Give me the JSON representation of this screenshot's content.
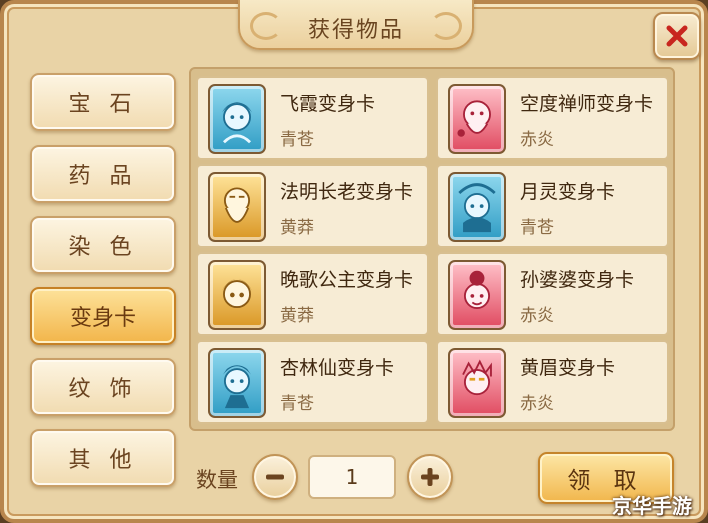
{
  "title": "获得物品",
  "colors": {
    "panel_bg": "#e9d3a6",
    "active_tab": "#f2b54a",
    "close_x": "#c8261f"
  },
  "categories": [
    {
      "label": "宝 石",
      "active": false
    },
    {
      "label": "药 品",
      "active": false
    },
    {
      "label": "染 色",
      "active": false
    },
    {
      "label": "变身卡",
      "active": true
    },
    {
      "label": "纹 饰",
      "active": false
    },
    {
      "label": "其 他",
      "active": false
    }
  ],
  "items": [
    {
      "name": "飞霞变身卡",
      "tier": "青苍",
      "icon": "blue-hero-portrait-icon"
    },
    {
      "name": "空度禅师变身卡",
      "tier": "赤炎",
      "icon": "red-monk-portrait-icon"
    },
    {
      "name": "法明长老变身卡",
      "tier": "黄莽",
      "icon": "gold-elder-portrait-icon"
    },
    {
      "name": "月灵变身卡",
      "tier": "青苍",
      "icon": "blue-spirit-portrait-icon"
    },
    {
      "name": "晚歌公主变身卡",
      "tier": "黄莽",
      "icon": "gold-princess-portrait-icon"
    },
    {
      "name": "孙婆婆变身卡",
      "tier": "赤炎",
      "icon": "red-granny-portrait-icon"
    },
    {
      "name": "杏林仙变身卡",
      "tier": "青苍",
      "icon": "blue-fairy-portrait-icon"
    },
    {
      "name": "黄眉变身卡",
      "tier": "赤炎",
      "icon": "red-yellowbrow-portrait-icon"
    }
  ],
  "quantity": {
    "label": "数量",
    "value": "1"
  },
  "claim_label": "领 取",
  "watermark": "京华手游"
}
